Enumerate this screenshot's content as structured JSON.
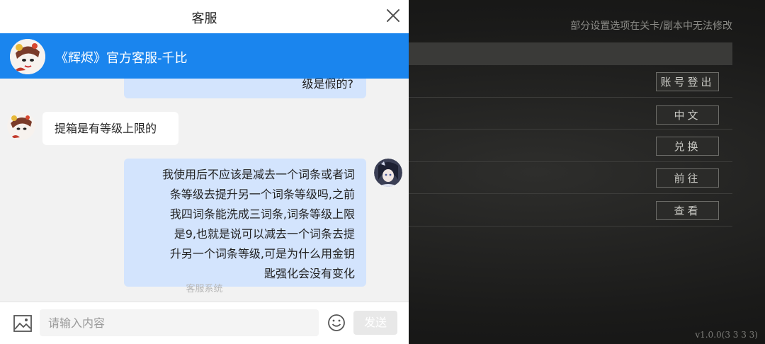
{
  "panel": {
    "title": "客服",
    "agent_name": "《辉烬》官方客服-千比"
  },
  "chat": {
    "messages": [
      {
        "from": "user",
        "text": "级是假的?"
      },
      {
        "from": "agent",
        "text": "提箱是有等级上限的"
      },
      {
        "from": "user",
        "lines": [
          "我使用后不应该是减去一个词条或者词",
          "条等级去提升另一个词条等级吗,之前",
          "我四词条能洗成三词条,词条等级上限",
          "是9,也就是说可以减去一个词条去提",
          "升另一个词条等级,可是为什么用金钥",
          "匙强化会没有变化"
        ]
      }
    ],
    "system_note": "客服系统"
  },
  "input": {
    "placeholder": "请输入内容",
    "value": "",
    "send_label": "发送"
  },
  "game": {
    "note": "部分设置选项在关卡/副本中无法修改",
    "buttons": [
      "账号登出",
      "中文",
      "兑换",
      "前往",
      "查看"
    ],
    "version": "v1.0.0(3 3 3 3)"
  },
  "colors": {
    "accent": "#1a85ee",
    "user_bubble": "#d3e4fd",
    "agent_bubble": "#ffffff"
  }
}
